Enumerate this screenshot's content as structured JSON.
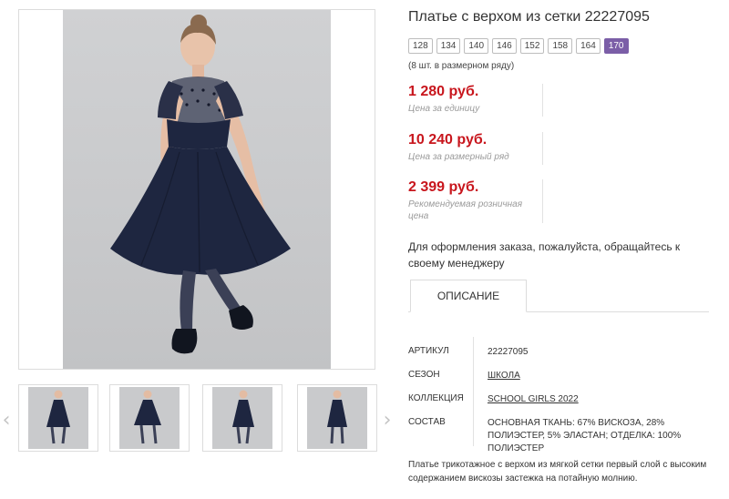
{
  "product": {
    "title": "Платье с верхом из сетки 22227095"
  },
  "gallery": {
    "thumbs_count": 4,
    "prev_icon": "chevron-left-icon",
    "next_icon": "chevron-right-icon"
  },
  "sizes": {
    "items": [
      "128",
      "134",
      "140",
      "146",
      "152",
      "158",
      "164",
      "170"
    ],
    "selected": "170",
    "note": "(8 шт. в размерном ряду)"
  },
  "prices": [
    {
      "value": "1 280 руб.",
      "label": "Цена за единицу"
    },
    {
      "value": "10 240 руб.",
      "label": "Цена за размерный ряд"
    },
    {
      "value": "2 399 руб.",
      "label": "Рекомендуемая розничная цена"
    }
  ],
  "notice": "Для оформления заказа, пожалуйста, обращайтесь к своему менеджеру",
  "tabs": {
    "description_label": "ОПИСАНИЕ"
  },
  "specs": [
    {
      "key": "АРТИКУЛ",
      "value": "22227095",
      "link": false
    },
    {
      "key": "СЕЗОН",
      "value": "ШКОЛА",
      "link": true
    },
    {
      "key": "КОЛЛЕКЦИЯ",
      "value": "SCHOOL GIRLS 2022",
      "link": true
    },
    {
      "key": "СОСТАВ",
      "value": "ОСНОВНАЯ ТКАНЬ: 67% ВИСКОЗА, 28% ПОЛИЭСТЕР, 5% ЭЛАСТАН; ОТДЕЛКА: 100% ПОЛИЭСТЕР",
      "link": false
    }
  ],
  "description": "Платье трикотажное с верхом из мягкой сетки первый слой с высоким содержанием вискозы застежка на потайную молнию.",
  "colors": {
    "price_red": "#c8161d",
    "selected_size_purple": "#7b5ea7",
    "dress_navy": "#1e2640"
  }
}
